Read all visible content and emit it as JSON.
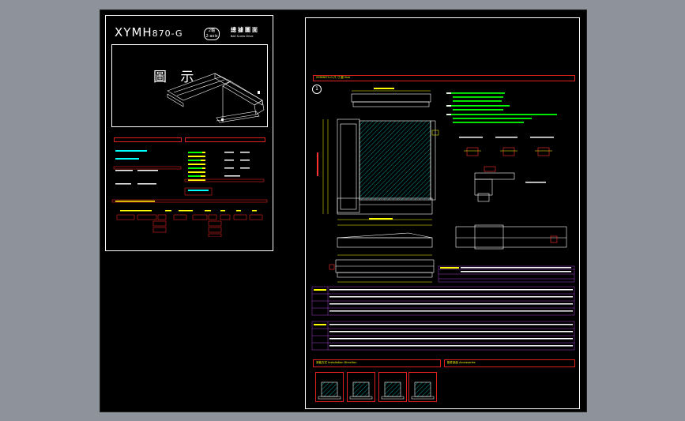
{
  "left_panel": {
    "model_prefix": "XYMH",
    "model_suffix": "870-G",
    "badge": "2軸",
    "badge_sub": "2-axis",
    "title_cn": "總據圖面",
    "title_en": "Ball Screw Drive",
    "thumb_label": "圖 示"
  },
  "right_panel": {
    "section_title": "XYMH870-G  尺 寸 圖  Size",
    "callout": "1",
    "installation_title": "安裝方式  Installation Direction",
    "accessories_title": "配件部品  Accessories"
  },
  "colors": {
    "background": "#8e929a",
    "sheet": "#000000",
    "border": "#ffffff",
    "accent_red": "#e02020",
    "accent_yellow": "#ffff00",
    "accent_green": "#00ff00",
    "accent_cyan": "#00ffff",
    "accent_purple": "#a040d0"
  }
}
